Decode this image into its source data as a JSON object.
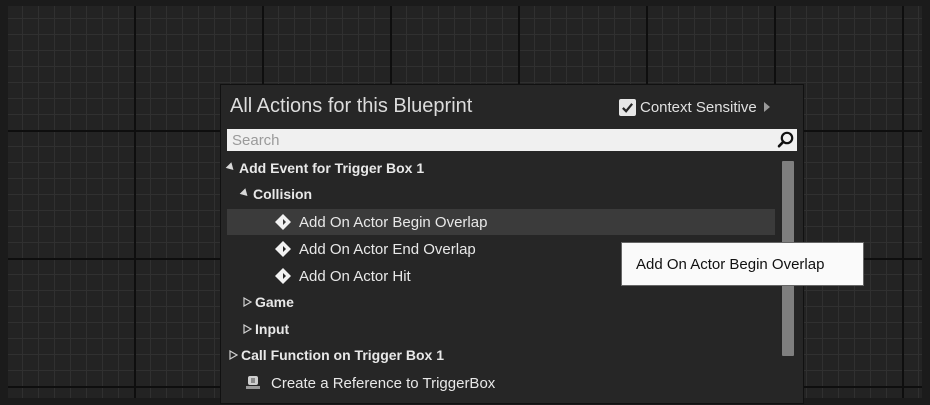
{
  "menu": {
    "title": "All Actions for this Blueprint",
    "context_sensitive_label": "Context Sensitive",
    "context_sensitive_checked": true,
    "search_placeholder": "Search"
  },
  "tree": {
    "group_event": "Add Event for Trigger Box 1",
    "category_collision": "Collision",
    "item_begin_overlap": "Add On Actor Begin Overlap",
    "item_end_overlap": "Add On Actor End Overlap",
    "item_hit": "Add On Actor Hit",
    "category_game": "Game",
    "category_input": "Input",
    "group_call_function": "Call Function on Trigger Box 1",
    "item_create_reference": "Create a Reference to TriggerBox"
  },
  "tooltip": {
    "text": "Add On Actor Begin Overlap"
  },
  "colors": {
    "graph_background": "#232323",
    "menu_background": "#262626",
    "selected_row": "#3b3b3b",
    "tooltip_background": "#fafafa"
  },
  "icons": {
    "checkbox": "check-icon",
    "search": "search-icon",
    "event": "event-diamond-icon",
    "reference": "reference-icon"
  }
}
